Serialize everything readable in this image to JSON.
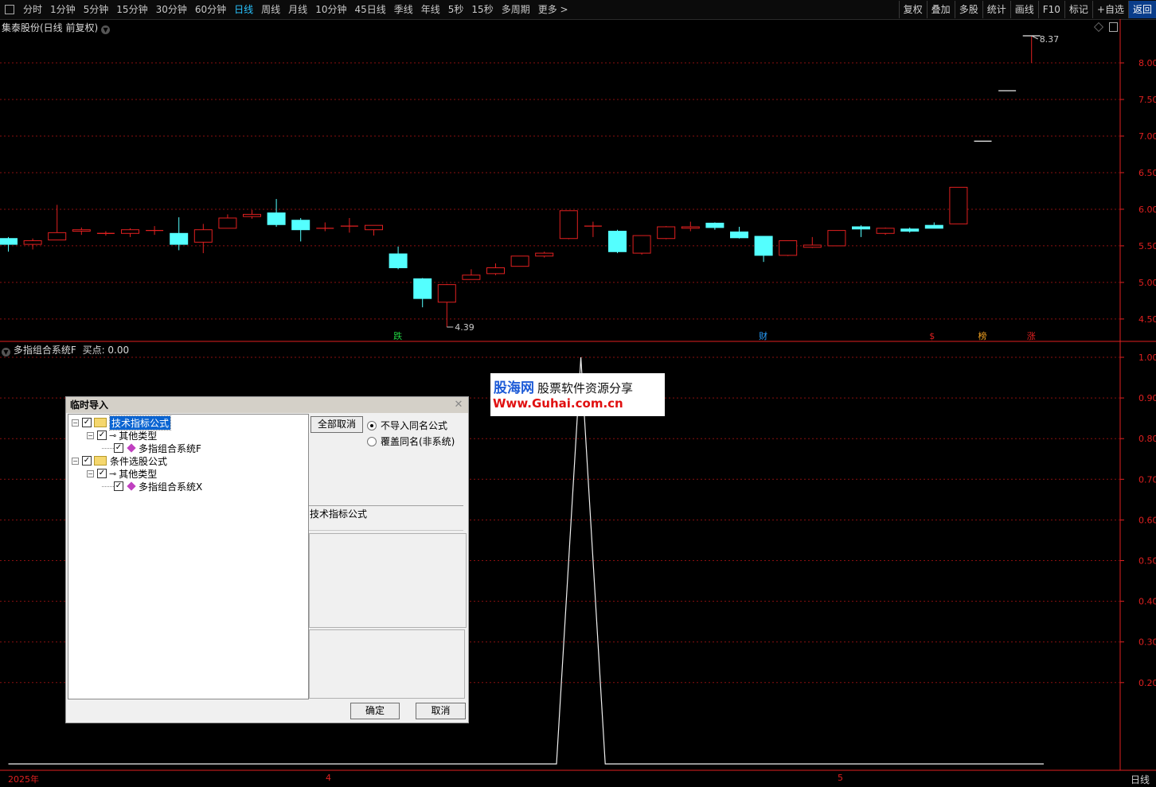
{
  "toolbar": {
    "periods": [
      "分时",
      "1分钟",
      "5分钟",
      "15分钟",
      "30分钟",
      "60分钟",
      "日线",
      "周线",
      "月线",
      "10分钟",
      "45日线",
      "季线",
      "年线",
      "5秒",
      "15秒",
      "多周期",
      "更多 >"
    ],
    "active_period": "日线",
    "right_buttons": [
      "复权",
      "叠加",
      "多股",
      "统计",
      "画线",
      "F10",
      "标记",
      "+自选",
      "返回"
    ]
  },
  "main_pane": {
    "title": "集泰股份(日线 前复权)",
    "price_axis": [
      "8.00",
      "7.50",
      "7.00",
      "6.50",
      "6.00",
      "5.50",
      "5.00",
      "4.50"
    ],
    "high_label": "8.37",
    "low_label": "4.39",
    "markers": [
      {
        "text": "跌",
        "color": "#20d040"
      },
      {
        "text": "财",
        "color": "#29a0ff"
      },
      {
        "text": "$",
        "color": "#e02020"
      },
      {
        "text": "榜",
        "color": "#f0a020"
      },
      {
        "text": "涨",
        "color": "#e02020"
      }
    ],
    "colors": {
      "up": "#e02020",
      "down": "#54ffff",
      "grid": "#8a1010",
      "axis": "#e02020"
    }
  },
  "chart_data": [
    {
      "type": "candlestick",
      "title": "集泰股份(日线 前复权)",
      "ylim": [
        4.2,
        8.6
      ],
      "candles": [
        {
          "o": 5.6,
          "h": 5.62,
          "l": 5.42,
          "c": 5.52
        },
        {
          "o": 5.52,
          "h": 5.6,
          "l": 5.45,
          "c": 5.57
        },
        {
          "o": 5.58,
          "h": 6.06,
          "l": 5.58,
          "c": 5.68
        },
        {
          "o": 5.7,
          "h": 5.75,
          "l": 5.65,
          "c": 5.72
        },
        {
          "o": 5.66,
          "h": 5.7,
          "l": 5.64,
          "c": 5.67
        },
        {
          "o": 5.67,
          "h": 5.74,
          "l": 5.62,
          "c": 5.72
        },
        {
          "o": 5.71,
          "h": 5.77,
          "l": 5.65,
          "c": 5.71
        },
        {
          "o": 5.67,
          "h": 5.89,
          "l": 5.44,
          "c": 5.52
        },
        {
          "o": 5.55,
          "h": 5.8,
          "l": 5.4,
          "c": 5.72
        },
        {
          "o": 5.74,
          "h": 5.93,
          "l": 5.74,
          "c": 5.88
        },
        {
          "o": 5.9,
          "h": 5.99,
          "l": 5.87,
          "c": 5.93
        },
        {
          "o": 5.95,
          "h": 6.14,
          "l": 5.76,
          "c": 5.79
        },
        {
          "o": 5.85,
          "h": 5.88,
          "l": 5.56,
          "c": 5.72
        },
        {
          "o": 5.74,
          "h": 5.82,
          "l": 5.7,
          "c": 5.74
        },
        {
          "o": 5.77,
          "h": 5.88,
          "l": 5.68,
          "c": 5.77
        },
        {
          "o": 5.72,
          "h": 5.78,
          "l": 5.64,
          "c": 5.78
        },
        {
          "o": 5.39,
          "h": 5.49,
          "l": 5.18,
          "c": 5.2
        },
        {
          "o": 5.05,
          "h": 5.06,
          "l": 4.66,
          "c": 4.78
        },
        {
          "o": 4.73,
          "h": 4.98,
          "l": 4.39,
          "c": 4.97
        },
        {
          "o": 5.04,
          "h": 5.18,
          "l": 5.04,
          "c": 5.1
        },
        {
          "o": 5.12,
          "h": 5.26,
          "l": 5.1,
          "c": 5.2
        },
        {
          "o": 5.22,
          "h": 5.36,
          "l": 5.22,
          "c": 5.36
        },
        {
          "o": 5.36,
          "h": 5.42,
          "l": 5.34,
          "c": 5.4
        },
        {
          "o": 5.6,
          "h": 5.98,
          "l": 5.59,
          "c": 5.98
        },
        {
          "o": 5.77,
          "h": 5.83,
          "l": 5.62,
          "c": 5.77
        },
        {
          "o": 5.7,
          "h": 5.72,
          "l": 5.4,
          "c": 5.42
        },
        {
          "o": 5.4,
          "h": 5.64,
          "l": 5.38,
          "c": 5.64
        },
        {
          "o": 5.6,
          "h": 5.77,
          "l": 5.59,
          "c": 5.76
        },
        {
          "o": 5.74,
          "h": 5.83,
          "l": 5.7,
          "c": 5.76
        },
        {
          "o": 5.81,
          "h": 5.82,
          "l": 5.72,
          "c": 5.75
        },
        {
          "o": 5.69,
          "h": 5.76,
          "l": 5.6,
          "c": 5.61
        },
        {
          "o": 5.63,
          "h": 5.63,
          "l": 5.28,
          "c": 5.37
        },
        {
          "o": 5.37,
          "h": 5.57,
          "l": 5.36,
          "c": 5.57
        },
        {
          "o": 5.48,
          "h": 5.62,
          "l": 5.47,
          "c": 5.51
        },
        {
          "o": 5.5,
          "h": 5.71,
          "l": 5.5,
          "c": 5.71
        },
        {
          "o": 5.76,
          "h": 5.78,
          "l": 5.62,
          "c": 5.73
        },
        {
          "o": 5.67,
          "h": 5.75,
          "l": 5.65,
          "c": 5.74
        },
        {
          "o": 5.73,
          "h": 5.75,
          "l": 5.68,
          "c": 5.7
        },
        {
          "o": 5.78,
          "h": 5.82,
          "l": 5.74,
          "c": 5.74
        },
        {
          "o": 5.8,
          "h": 6.3,
          "l": 5.8,
          "c": 6.3
        },
        {
          "o": 6.93,
          "h": 6.93,
          "l": 6.93,
          "c": 6.93
        },
        {
          "o": 7.62,
          "h": 7.62,
          "l": 7.62,
          "c": 7.62
        },
        {
          "o": 8.37,
          "h": 8.37,
          "l": 8.0,
          "c": 8.37
        }
      ]
    },
    {
      "type": "line",
      "title": "多指组合系统F  买点: 0.00",
      "ylim": [
        0,
        1.05
      ],
      "y_ticks": [
        "1.00",
        "0.90",
        "0.80",
        "0.70",
        "0.60",
        "0.50",
        "0.40",
        "0.30",
        "0.20"
      ],
      "points": [
        [
          0,
          0
        ],
        [
          22.5,
          0
        ],
        [
          23.5,
          1.0
        ],
        [
          24.5,
          0
        ],
        [
          42.5,
          0
        ]
      ]
    }
  ],
  "sub_pane": {
    "title": "多指组合系统F",
    "buy_label": "买点: 0.00"
  },
  "x_axis": {
    "labels": [
      "2025年",
      "4",
      "5"
    ],
    "period": "日线"
  },
  "dialog": {
    "title": "临时导入",
    "tree": [
      {
        "label": "技术指标公式",
        "level": 0,
        "kind": "folder",
        "selected": true
      },
      {
        "label": "其他类型",
        "level": 1,
        "kind": "key"
      },
      {
        "label": "多指组合系统F",
        "level": 2,
        "kind": "item"
      },
      {
        "label": "条件选股公式",
        "level": 0,
        "kind": "folder"
      },
      {
        "label": "其他类型",
        "level": 1,
        "kind": "key"
      },
      {
        "label": "多指组合系统X",
        "level": 2,
        "kind": "item"
      }
    ],
    "cancel_all": "全部取消",
    "radio_no_import": "不导入同名公式",
    "radio_overwrite": "覆盖同名(非系统)",
    "info_label": "技术指标公式",
    "ok": "确定",
    "cancel": "取消"
  },
  "watermark": {
    "site": "股海网",
    "tagline": "股票软件资源分享",
    "url": "Www.Guhai.com.cn"
  }
}
